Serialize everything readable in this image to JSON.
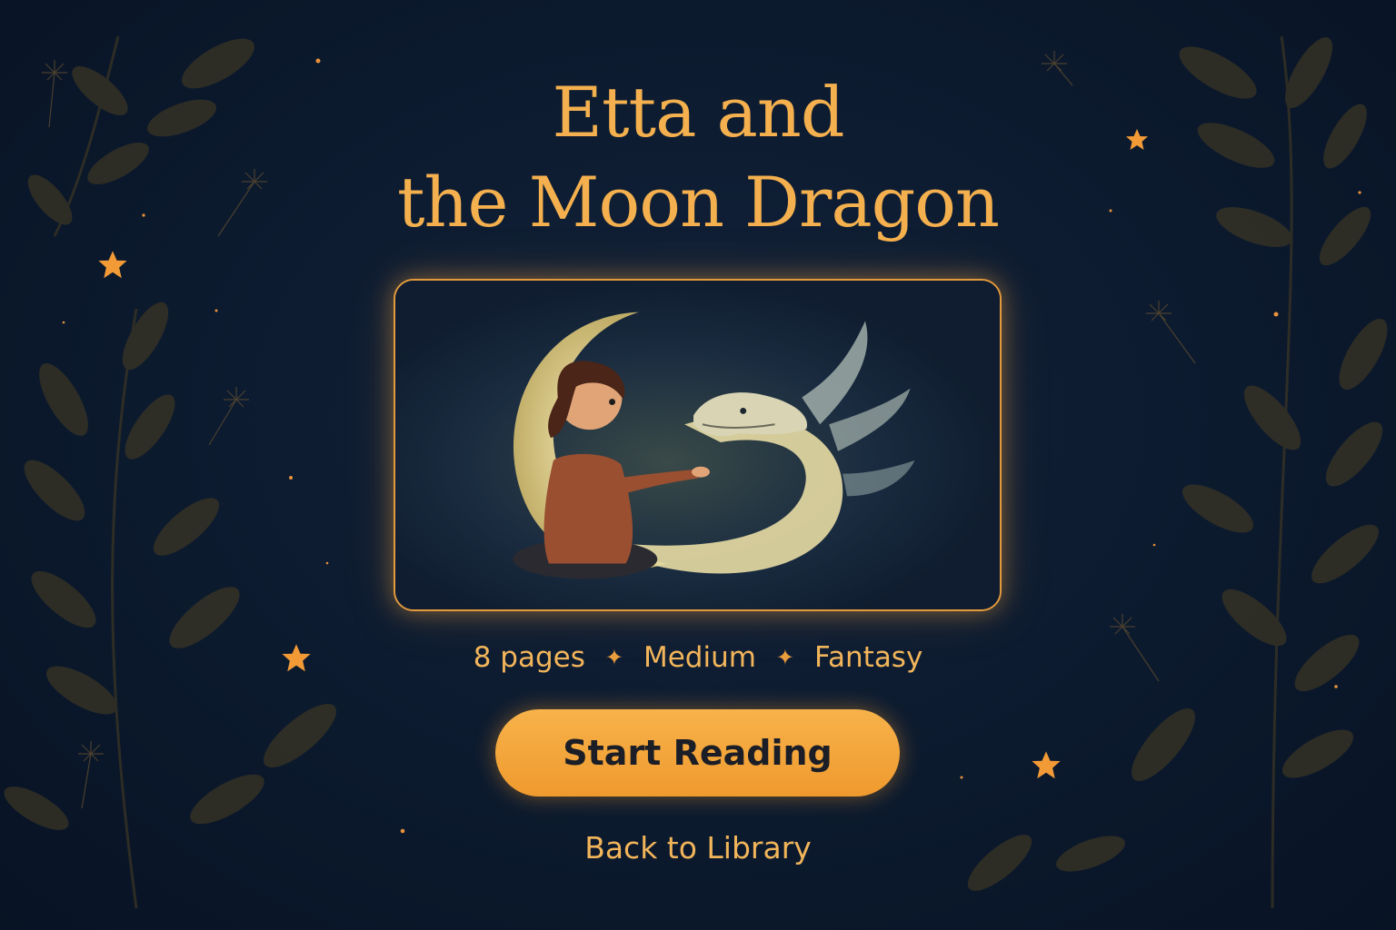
{
  "book": {
    "title_line1": "Etta and",
    "title_line2": "the Moon Dragon",
    "cover_alt": "Illustration of a girl reaching toward a glowing moon dragon beside a crescent moon"
  },
  "meta": {
    "pages": "8 pages",
    "difficulty": "Medium",
    "genre": "Fantasy",
    "separator_icon": "sparkle-icon"
  },
  "actions": {
    "start_label": "Start Reading",
    "back_label": "Back to Library"
  },
  "colors": {
    "background": "#0c1a2e",
    "accent": "#f4b04e",
    "button": "#f2a33a",
    "button_text": "#1b1e26"
  }
}
